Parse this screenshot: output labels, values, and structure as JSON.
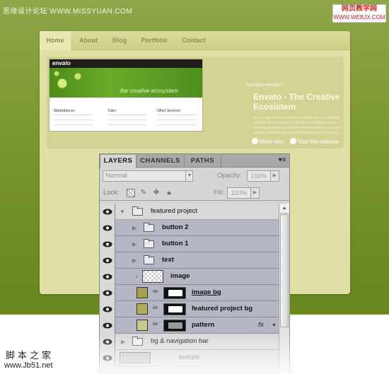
{
  "watermarks": {
    "top_left": "思缘设计论坛 WWW.MISSYUAN.COM",
    "top_right_line1": "网页教学网",
    "top_right_line2": "WWW.WEBJX.COM",
    "bottom_left_line1": "脚本之家",
    "bottom_left_line2": "www.Jb51.net"
  },
  "site": {
    "nav": [
      "Home",
      "About",
      "Blog",
      "Portfolio",
      "Contact"
    ],
    "featured_caption": "FEATURED PROJECT",
    "featured_title": "Envato - The Creative Ecosistem",
    "featured_description": "Sed ut odio fermentum enim convallis ultricies. Aliquam convallis lacus ut purus. Pellentesque habitant morbi tristique senectus et netus et malesuada fames ac turpis egestas. Aliquam quis arcu. Maecenas ac ante a justo facilisis ultricies. Aliquam erat volutpat. Fusce quis arcu. Praesent vestibulum. Aliquam convallis lacus.",
    "more_info": "More info",
    "visit_website": "Visit the website",
    "screenshot": {
      "logo": "envato",
      "tagline": "the creative ecosystem",
      "col1": "Marketplaces",
      "col2": "Tuts+",
      "col3": "Other Services"
    }
  },
  "layers_panel": {
    "tabs": [
      "LAYERS",
      "CHANNELS",
      "PATHS"
    ],
    "blend_mode": "Normal",
    "opacity_label": "Opacity:",
    "opacity_value": "100%",
    "lock_label": "Lock:",
    "fill_label": "Fill:",
    "fill_value": "100%",
    "fx_label": "fx",
    "layers": [
      {
        "name": "featured project",
        "kind": "group",
        "expanded": true
      },
      {
        "name": "button 2",
        "kind": "group"
      },
      {
        "name": "button 1",
        "kind": "group"
      },
      {
        "name": "text",
        "kind": "group"
      },
      {
        "name": "image",
        "kind": "layer"
      },
      {
        "name": "image bg",
        "kind": "layer"
      },
      {
        "name": "featured project bg",
        "kind": "layer"
      },
      {
        "name": "pattern",
        "kind": "layer",
        "effects": true
      },
      {
        "name": "bg & navigation bar",
        "kind": "group"
      },
      {
        "name": "texture",
        "kind": "layer"
      }
    ]
  },
  "colors": {
    "background_green": "#6f8c22",
    "site_bg": "#e0e0a4",
    "selected_layer": "#b6b7c4"
  }
}
